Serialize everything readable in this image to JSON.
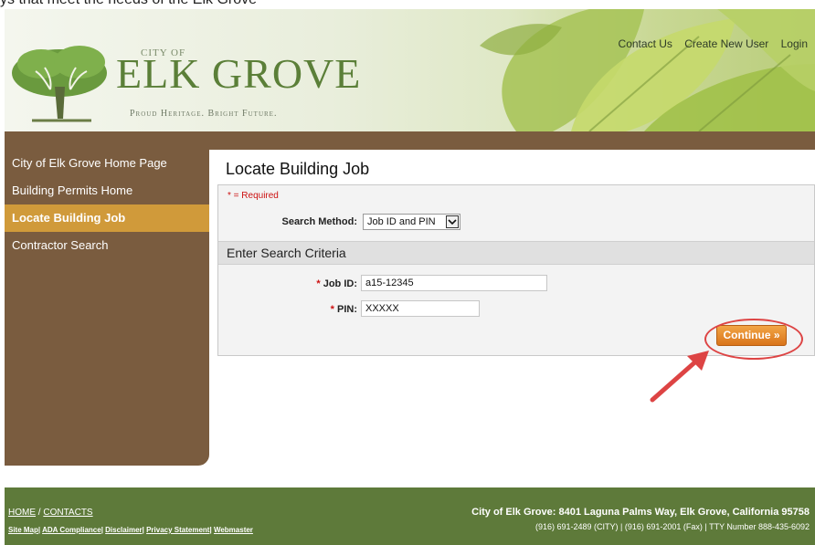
{
  "top_strip_text": "ys that meet the needs of the Elk Grove",
  "header": {
    "logo": {
      "city_of": "City of",
      "name": "Elk Grove",
      "tagline": "Proud Heritage. Bright Future."
    },
    "links": [
      "Contact Us",
      "Create New User",
      "Login"
    ]
  },
  "sidebar": {
    "items": [
      {
        "label": "City of Elk Grove Home Page",
        "active": false
      },
      {
        "label": "Building Permits Home",
        "active": false
      },
      {
        "label": "Locate Building Job",
        "active": true
      },
      {
        "label": "Contractor Search",
        "active": false
      }
    ]
  },
  "main": {
    "title": "Locate Building Job",
    "required_note": "* = Required",
    "search_method": {
      "label": "Search Method:",
      "value": "Job ID and PIN"
    },
    "section_header": "Enter Search Criteria",
    "job_id": {
      "label": "Job ID:",
      "value": "a15-12345"
    },
    "pin": {
      "label": "PIN:",
      "value": "XXXXX"
    },
    "continue_label": "Continue »"
  },
  "footer": {
    "home": "HOME",
    "sep": "/",
    "contacts": "CONTACTS",
    "links": [
      "Site Map",
      "ADA Compliance",
      "Disclaimer",
      "Privacy Statement",
      "Webmaster"
    ],
    "address": "City of Elk Grove: 8401 Laguna Palms Way, Elk Grove, California 95758",
    "phones": "(916) 691-2489 (CITY) | (916) 691-2001 (Fax) | TTY Number 888-435-6092"
  },
  "colors": {
    "brown": "#7a5c3f",
    "active": "#d09a3a",
    "footer": "#5e7a3a",
    "button": "#e0801f",
    "annotation": "#dd4444"
  }
}
